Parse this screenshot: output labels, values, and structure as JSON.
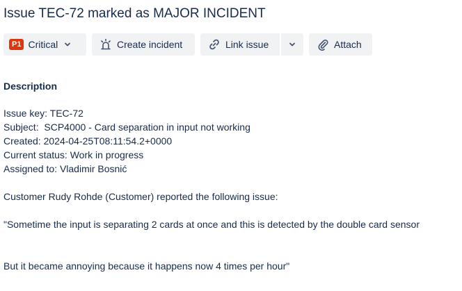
{
  "header": {
    "title": "Issue TEC-72 marked as MAJOR INCIDENT"
  },
  "toolbar": {
    "priority_badge": "P1",
    "priority_label": "Critical",
    "create_incident_label": "Create incident",
    "link_issue_label": "Link issue",
    "attach_label": "Attach"
  },
  "description": {
    "heading": "Description",
    "issue_key": "Issue key: TEC-72",
    "subject": "Subject:  SCP4000 - Card separation in input not working",
    "created": "Created: 2024-04-25T08:11:54.2+0000",
    "status": "Current status: Work in progress",
    "assigned": "Assigned to: Vladimir Bosnić",
    "reporter_line": "Customer Rudy Rohde (Customer) reported the following issue:",
    "quote_line_1": "\"Sometime the input is separating 2 cards at once and this is detected by the double card sensor",
    "quote_line_2": "But it became annoying because it happens now 4 times per hour\""
  },
  "colors": {
    "text": "#172b4d",
    "button_bg": "#f1f2f4",
    "priority_badge": "#de350b"
  },
  "icons": [
    "chevron-down-icon",
    "siren-icon",
    "link-icon",
    "paperclip-icon"
  ]
}
